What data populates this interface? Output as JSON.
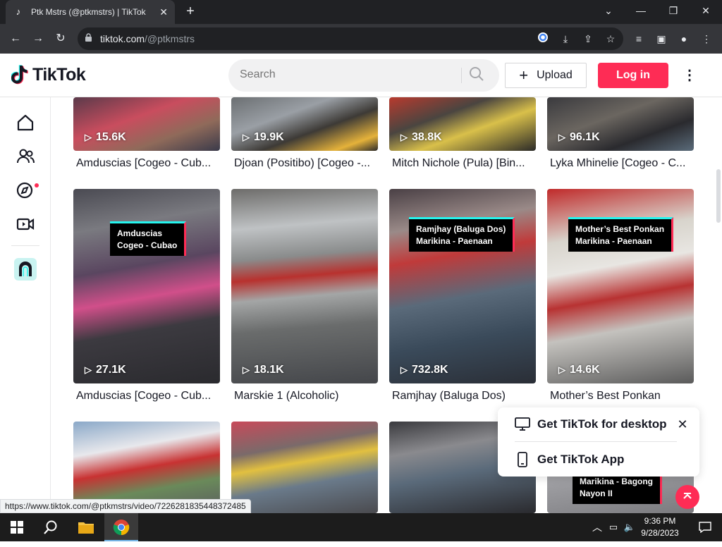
{
  "browser": {
    "tab_title": "Ptk Mstrs (@ptkmstrs) | TikTok",
    "url_domain": "tiktok.com",
    "url_path": "/@ptkmstrs",
    "status_url": "https://www.tiktok.com/@ptkmstrs/video/7226281835448372485"
  },
  "header": {
    "logo_text": "TikTok",
    "search_placeholder": "Search",
    "upload_label": "Upload",
    "login_label": "Log in"
  },
  "sidebar": {
    "items": [
      {
        "name": "home-icon"
      },
      {
        "name": "following-icon"
      },
      {
        "name": "explore-icon"
      },
      {
        "name": "live-icon"
      },
      {
        "name": "profile-avatar"
      }
    ]
  },
  "videos": {
    "row1": [
      {
        "views": "15.6K",
        "caption": "Amduscias [Cogeo - Cub..."
      },
      {
        "views": "19.9K",
        "caption": "Djoan (Positibo) [Cogeo -..."
      },
      {
        "views": "38.8K",
        "caption": "Mitch Nichole (Pula) [Bin..."
      },
      {
        "views": "96.1K",
        "caption": "Lyka Mhinelie [Cogeo - C..."
      }
    ],
    "row2": [
      {
        "views": "27.1K",
        "caption": "Amduscias [Cogeo - Cub...",
        "overlay": "Amduscias\nCogeo - Cubao"
      },
      {
        "views": "18.1K",
        "caption": "Marskie 1 (Alcoholic)",
        "overlay": ""
      },
      {
        "views": "732.8K",
        "caption": "Ramjhay (Baluga Dos)",
        "overlay": "Ramjhay (Baluga Dos)\nMarikina - Paenaan"
      },
      {
        "views": "14.6K",
        "caption": "Mother’s Best Ponkan",
        "overlay": "Mother’s Best Ponkan\nMarikina - Paenaan"
      }
    ],
    "row3_overlay": "Marikina - Bagong\nNayon II"
  },
  "popup": {
    "desktop_label": "Get TikTok for desktop",
    "app_label": "Get TikTok App"
  },
  "taskbar": {
    "time": "9:36 PM",
    "date": "9/28/2023"
  },
  "colors": {
    "brand_red": "#fe2c55",
    "brand_cyan": "#25f4ee",
    "chrome_dark": "#202124",
    "chrome_toolbar": "#35363a"
  }
}
